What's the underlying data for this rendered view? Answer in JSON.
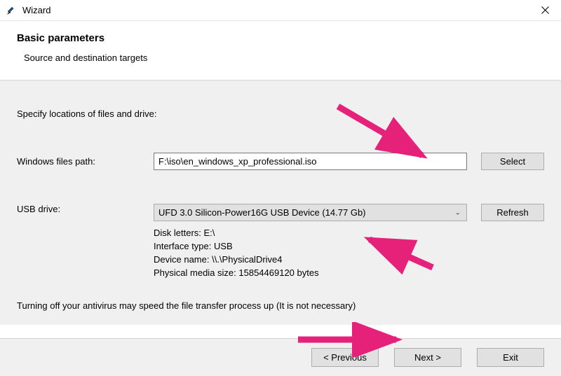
{
  "window": {
    "title": "Wizard"
  },
  "header": {
    "title": "Basic parameters",
    "subtitle": "Source and destination targets"
  },
  "panel": {
    "instruction": "Specify locations of files and drive:",
    "files_path_label": "Windows files path:",
    "files_path_value": "F:\\iso\\en_windows_xp_professional.iso",
    "select_label": "Select",
    "usb_label": "USB drive:",
    "usb_selected": "UFD 3.0 Silicon-Power16G USB Device (14.77 Gb)",
    "refresh_label": "Refresh",
    "details": {
      "disk_letters": "Disk letters: E:\\",
      "interface": "Interface type: USB",
      "device_name": "Device name: \\\\.\\PhysicalDrive4",
      "media_size": "Physical media size: 15854469120 bytes"
    },
    "note": "Turning off your antivirus may speed the file transfer process up (It is not necessary)"
  },
  "footer": {
    "previous": "< Previous",
    "next": "Next >",
    "exit": "Exit"
  }
}
